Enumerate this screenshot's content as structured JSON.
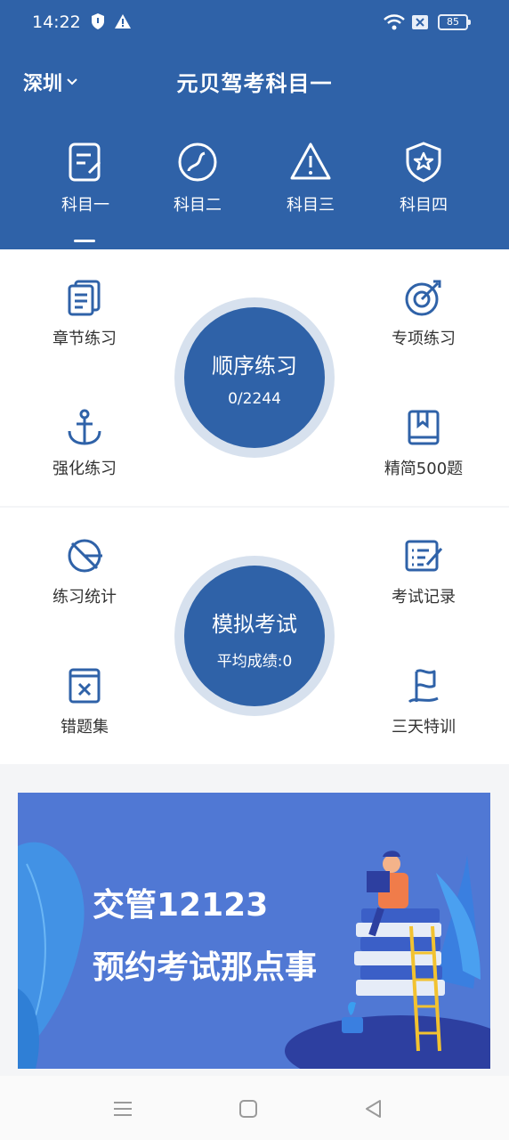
{
  "status_bar": {
    "time": "14:22",
    "battery": "85"
  },
  "header": {
    "city": "深圳",
    "title": "元贝驾考科目一"
  },
  "subjects": [
    {
      "label": "科目一",
      "icon": "edit-icon"
    },
    {
      "label": "科目二",
      "icon": "steering-icon"
    },
    {
      "label": "科目三",
      "icon": "warning-icon"
    },
    {
      "label": "科目四",
      "icon": "shield-star-icon"
    }
  ],
  "practice": {
    "chapter": "章节练习",
    "special": "专项练习",
    "intensive": "强化练习",
    "selected500": "精简500题",
    "sequential": {
      "title": "顺序练习",
      "progress": "0/2244"
    }
  },
  "exam": {
    "stats": "练习统计",
    "records": "考试记录",
    "mistakes": "错题集",
    "training": "三天特训",
    "mock": {
      "title": "模拟考试",
      "score": "平均成绩:0"
    }
  },
  "banner": {
    "line1": "交管12123",
    "line2": "预约考试那点事"
  },
  "colors": {
    "primary": "#2f62a8",
    "ring": "#d7e1ee",
    "banner": "#5078d4"
  }
}
